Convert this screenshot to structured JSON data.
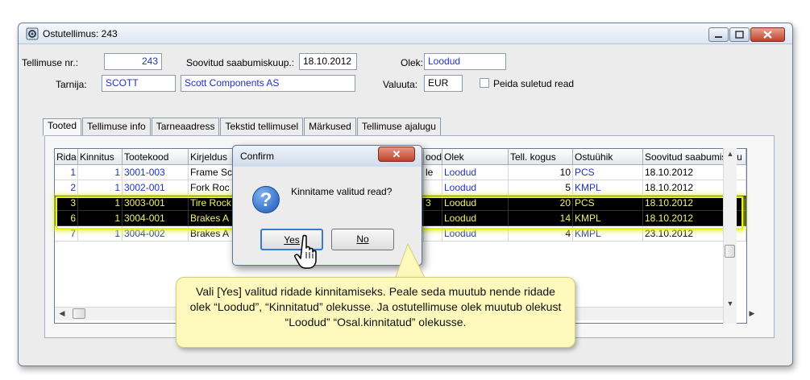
{
  "window": {
    "title": "Ostutellimus: 243",
    "buttons": {
      "minimize": "—",
      "maximize": "▫",
      "close": "✕"
    }
  },
  "form": {
    "order_no_label": "Tellimuse nr.:",
    "order_no_value": "243",
    "arrival_label": "Soovitud saabumiskuup.:",
    "arrival_value": "18.10.2012",
    "status_label": "Olek:",
    "status_value": "Loodud",
    "supplier_label": "Tarnija:",
    "supplier_code": "SCOTT",
    "supplier_name": "Scott Components AS",
    "currency_label": "Valuuta:",
    "currency_value": "EUR",
    "hide_closed_label": "Peida suletud read"
  },
  "tabs": [
    "Tooted",
    "Tellimuse info",
    "Tarneaadress",
    "Tekstid tellimusel",
    "Märkused",
    "Tellimuse ajalugu"
  ],
  "grid": {
    "headers": [
      "Rida",
      "Kinnitus",
      "Tootekood",
      "Kirjeldus",
      "",
      "ood",
      "Olek",
      "Tell. kogus",
      "Ostuühik",
      "Soovitud saabumiskuu"
    ],
    "rows": [
      {
        "rida": "1",
        "kinnitus": "1",
        "kood": "3001-003",
        "kirjeldus": "Frame Sc",
        "ood": "le",
        "olek": "Loodud",
        "kogus": "10",
        "yhik": "PCS",
        "kuup": "18.10.2012",
        "selected": false
      },
      {
        "rida": "2",
        "kinnitus": "1",
        "kood": "3002-001",
        "kirjeldus": "Fork Roc",
        "ood": "",
        "olek": "Loodud",
        "kogus": "5",
        "yhik": "KMPL",
        "kuup": "18.10.2012",
        "selected": false
      },
      {
        "rida": "3",
        "kinnitus": "1",
        "kood": "3003-001",
        "kirjeldus": "Tire Rock",
        "ood": "3",
        "olek": "Loodud",
        "kogus": "20",
        "yhik": "PCS",
        "kuup": "18.10.2012",
        "selected": true
      },
      {
        "rida": "6",
        "kinnitus": "1",
        "kood": "3004-001",
        "kirjeldus": "Brakes A",
        "ood": "",
        "olek": "Loodud",
        "kogus": "14",
        "yhik": "KMPL",
        "kuup": "18.10.2012",
        "selected": true
      },
      {
        "rida": "7",
        "kinnitus": "1",
        "kood": "3004-002",
        "kirjeldus": "Brakes A",
        "ood": "",
        "olek": "Loodud",
        "kogus": "4",
        "yhik": "KMPL",
        "kuup": "23.10.2012",
        "selected": false
      }
    ]
  },
  "dialog": {
    "title": "Confirm",
    "close": "✕",
    "message": "Kinnitame valitud read?",
    "icon": "?",
    "yes_label": "Yes",
    "no_label": "No"
  },
  "callout": {
    "text": "Vali [Yes] valitud ridade kinnitamiseks. Peale seda muutub nende ridade olek “Loodud”, “Kinnitatud” olekusse. Ja ostutellimuse olek muutub olekust “Loodud” “Osal.kinnitatud” olekusse."
  },
  "colors": {
    "accent": "#1f31c9",
    "highlight": "#e5f21e",
    "selected_text": "#f2f06b",
    "callout_bg": "#fdf9bc"
  }
}
